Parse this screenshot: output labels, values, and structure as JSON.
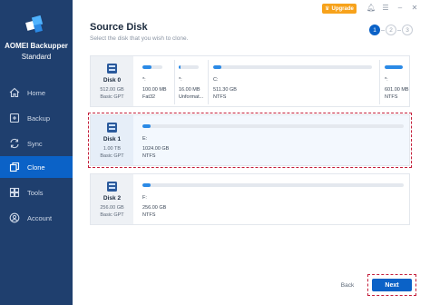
{
  "app": {
    "brand_line1": "AOMEI Backupper",
    "brand_line2": "Standard",
    "upgrade_label": "Upgrade"
  },
  "sidebar": {
    "items": [
      {
        "label": "Home",
        "icon": "home-icon"
      },
      {
        "label": "Backup",
        "icon": "backup-icon"
      },
      {
        "label": "Sync",
        "icon": "sync-icon"
      },
      {
        "label": "Clone",
        "icon": "clone-icon",
        "active": true
      },
      {
        "label": "Tools",
        "icon": "tools-icon"
      },
      {
        "label": "Account",
        "icon": "account-icon"
      }
    ]
  },
  "page": {
    "title": "Source Disk",
    "subtitle": "Select the disk that you wish to clone.",
    "steps": [
      "1",
      "2",
      "3"
    ],
    "active_step": 1
  },
  "disks": [
    {
      "name": "Disk 0",
      "size": "512.00 GB",
      "type": "Basic GPT",
      "partitions": [
        {
          "label": "*:",
          "size": "100.00 MB",
          "fs": "Fat32",
          "used": 0.45
        },
        {
          "label": "*:",
          "size": "16.00 MB",
          "fs": "Unformat...",
          "used": 0.1
        },
        {
          "label": "C:",
          "size": "511.30 GB",
          "fs": "NTFS",
          "used": 0.05
        },
        {
          "label": "*:",
          "size": "601.00 MB",
          "fs": "NTFS",
          "used": 1.0
        }
      ]
    },
    {
      "name": "Disk 1",
      "size": "1.00 TB",
      "type": "Basic GPT",
      "partitions": [
        {
          "label": "E:",
          "size": "1024.00 GB",
          "fs": "NTFS",
          "used": 0.01
        }
      ]
    },
    {
      "name": "Disk 2",
      "size": "256.00 GB",
      "type": "Basic GPT",
      "partitions": [
        {
          "label": "F:",
          "size": "256.00 GB",
          "fs": "NTFS",
          "used": 0.01
        }
      ]
    }
  ],
  "buttons": {
    "cancel_label": "Back",
    "next_label": "Next"
  },
  "colors": {
    "sidebar": "#1f3f6e",
    "accent": "#0b62c7",
    "upgrade": "#f7a21b",
    "highlight": "#c41e3a"
  }
}
